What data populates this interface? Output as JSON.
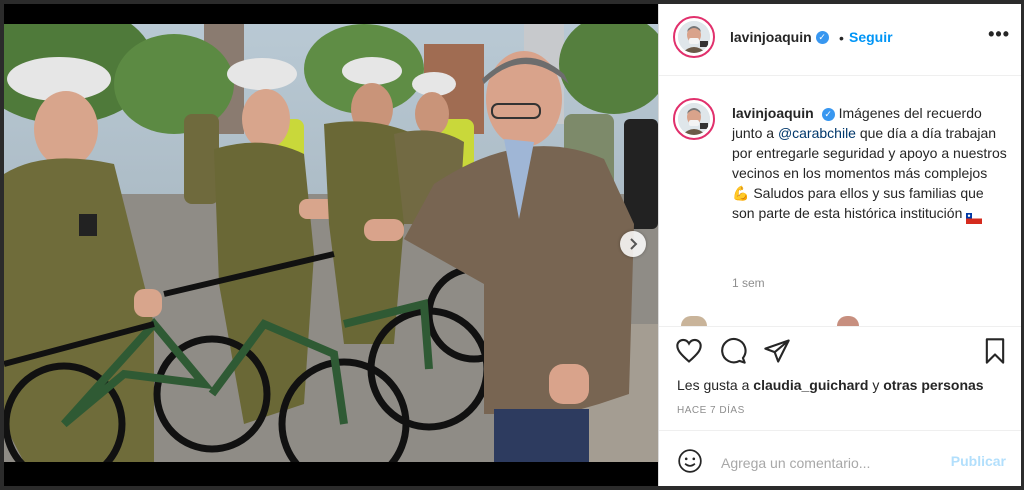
{
  "post": {
    "username": "lavinjoaquin",
    "follow_label": "Seguir",
    "more_label": "•••",
    "separator": "•",
    "caption_part1": "Imágenes del recuerdo junto a ",
    "caption_mention": "@carabchile",
    "caption_part2": " que día a día trabajan por entregarle seguridad y apoyo a nuestros vecinos en los momentos más complejos ",
    "caption_emoji": "💪",
    "caption_part3": " Saludos para ellos y sus familias que son parte de esta histórica institución ",
    "caption_time": "1 sem",
    "likes_prefix": "Les gusta a ",
    "likes_user": "claudia_guichard",
    "likes_and": " y ",
    "likes_others": "otras personas",
    "posted_ago": "HACE 7 DÍAS",
    "comment_placeholder": "Agrega un comentario...",
    "publish_label": "Publicar"
  },
  "icons": {
    "like": "heart-icon",
    "comment": "comment-icon",
    "share": "send-icon",
    "save": "bookmark-icon",
    "emoji": "smiley-icon",
    "next": "chevron-right-icon",
    "verified": "verified-badge-icon",
    "flag": "chile-flag-icon"
  },
  "colors": {
    "link": "#0095f6",
    "mention": "#00376b",
    "verified": "#3897f0",
    "story_ring": "#e1306c",
    "muted": "#8e8e8e",
    "publish_disabled": "#b2dffc"
  }
}
